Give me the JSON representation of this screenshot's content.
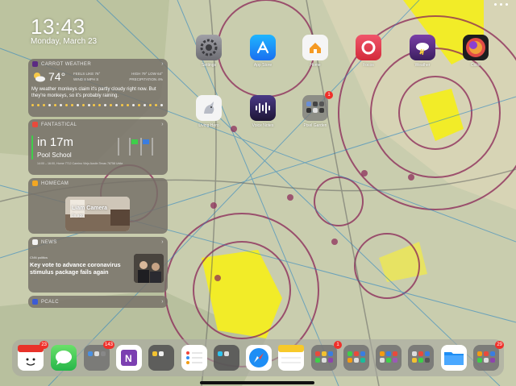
{
  "status": {
    "time": "13:43",
    "date": "Monday, March 23"
  },
  "widgets": {
    "weather": {
      "header": "CARROT WEATHER",
      "temp": "74°",
      "feels": "FEELS LIKE 76°",
      "wind": "WIND 8 MPH S",
      "high_low": "HIGH 79° LOW 64°",
      "precip": "PRECIPITATION 4%",
      "text": "My weather monkeys claim it's partly cloudy right now. But they're monkeys, so it's probably raining."
    },
    "calendar": {
      "header": "FANTASTICAL",
      "countdown": "in 17m",
      "event": "Pool School",
      "detail": "14:00 – 16:00, Home 7712 Camino Viejo Austin Texas 78758 Unite"
    },
    "camera": {
      "header": "HOMECAM",
      "title": "Liam Camera",
      "subtitle": "0s ago"
    },
    "news": {
      "header": "NEWS",
      "source": "CNN politics",
      "headline": "Key vote to advance coronavirus stimulus package fails again"
    },
    "pcalc": {
      "header": "PCALC"
    }
  },
  "apps": [
    {
      "name": "Settings",
      "color": "#8e8e93"
    },
    {
      "name": "App Store",
      "color": "#1c8ef5"
    },
    {
      "name": "Home",
      "color": "#f3f3f3"
    },
    {
      "name": "Focos",
      "color": "#ea3a4a"
    },
    {
      "name": "Weather",
      "color": "#5b2a83"
    },
    {
      "name": "Color",
      "color": "#e86d2a"
    },
    {
      "name": "Living Hero",
      "color": "#f4f4f4"
    },
    {
      "name": "Voice Notes",
      "color": "#35285e"
    },
    {
      "name": "Pixel Garden",
      "color": "#6f6f6f",
      "badge": "1"
    }
  ],
  "dock": [
    {
      "name": "Calendar",
      "badge": "23"
    },
    {
      "name": "Messages"
    },
    {
      "name": "Folder",
      "badge": "143"
    },
    {
      "name": "OneNote"
    },
    {
      "name": "Folder 2"
    },
    {
      "name": "Reminders"
    },
    {
      "name": "Folder 3"
    },
    {
      "name": "Safari"
    },
    {
      "name": "Notes"
    },
    {
      "name": "Folder 4",
      "badge": "1"
    },
    {
      "name": "Folder 5"
    },
    {
      "name": "Folder 6"
    },
    {
      "name": "Folder 7"
    },
    {
      "name": "Files"
    },
    {
      "name": "Folder 8",
      "badge": "29"
    }
  ]
}
